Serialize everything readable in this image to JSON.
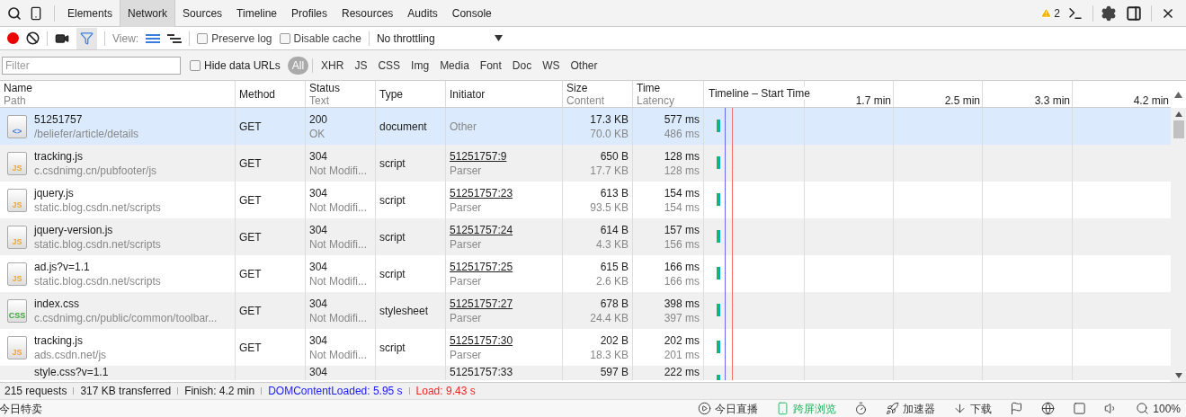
{
  "panel_tabs": [
    {
      "label": "Elements",
      "selected": false
    },
    {
      "label": "Network",
      "selected": true
    },
    {
      "label": "Sources",
      "selected": false
    },
    {
      "label": "Timeline",
      "selected": false
    },
    {
      "label": "Profiles",
      "selected": false
    },
    {
      "label": "Resources",
      "selected": false
    },
    {
      "label": "Audits",
      "selected": false
    },
    {
      "label": "Console",
      "selected": false
    }
  ],
  "warnings": {
    "count": "2"
  },
  "toolbar": {
    "recording": true,
    "filter_active": true,
    "view_label": "View:",
    "views": [
      {
        "kind": "list",
        "selected": true
      },
      {
        "kind": "overview",
        "selected": false
      }
    ],
    "options": [
      {
        "label": "Preserve log",
        "checked": false
      },
      {
        "label": "Disable cache",
        "checked": false
      }
    ],
    "throttling": "No throttling"
  },
  "filter_bar": {
    "placeholder": "Filter",
    "hide_data_urls": {
      "label": "Hide data URLs",
      "checked": false
    },
    "types": [
      {
        "label": "All",
        "selected": true
      },
      {
        "label": "XHR",
        "selected": false
      },
      {
        "label": "JS",
        "selected": false
      },
      {
        "label": "CSS",
        "selected": false
      },
      {
        "label": "Img",
        "selected": false
      },
      {
        "label": "Media",
        "selected": false
      },
      {
        "label": "Font",
        "selected": false
      },
      {
        "label": "Doc",
        "selected": false
      },
      {
        "label": "WS",
        "selected": false
      },
      {
        "label": "Other",
        "selected": false
      }
    ]
  },
  "table": {
    "columns": [
      {
        "title": "Name",
        "subtitle": "Path"
      },
      {
        "title": "Method"
      },
      {
        "title": "Status",
        "subtitle": "Text"
      },
      {
        "title": "Type"
      },
      {
        "title": "Initiator"
      },
      {
        "title": "Size",
        "subtitle": "Content"
      },
      {
        "title": "Time",
        "subtitle": "Latency"
      },
      {
        "title": "Timeline – Start Time"
      }
    ],
    "timeline_ticks": [
      "1.7 min",
      "2.5 min",
      "3.3 min",
      "4.2 min"
    ],
    "rows": [
      {
        "selected": true,
        "kind": "document",
        "icon_label": "<>",
        "name": "51251757",
        "path": "/beliefer/article/details",
        "method": "GET",
        "status": "200",
        "status_text": "OK",
        "type": "document",
        "initiator": "Other",
        "initiator_link": false,
        "size": "17.3 KB",
        "content": "70.0 KB",
        "time": "577 ms",
        "latency": "486 ms"
      },
      {
        "selected": false,
        "kind": "script",
        "icon_label": "JS",
        "name": "tracking.js",
        "path": "c.csdnimg.cn/pubfooter/js",
        "method": "GET",
        "status": "304",
        "status_text": "Not Modifi...",
        "type": "script",
        "initiator": "51251757:9",
        "initiator_link": true,
        "initiator_detail": "Parser",
        "size": "650 B",
        "content": "17.7 KB",
        "time": "128 ms",
        "latency": "128 ms"
      },
      {
        "selected": false,
        "kind": "script",
        "icon_label": "JS",
        "name": "jquery.js",
        "path": "static.blog.csdn.net/scripts",
        "method": "GET",
        "status": "304",
        "status_text": "Not Modifi...",
        "type": "script",
        "initiator": "51251757:23",
        "initiator_link": true,
        "initiator_detail": "Parser",
        "size": "613 B",
        "content": "93.5 KB",
        "time": "154 ms",
        "latency": "154 ms"
      },
      {
        "selected": false,
        "kind": "script",
        "icon_label": "JS",
        "name": "jquery-version.js",
        "path": "static.blog.csdn.net/scripts",
        "method": "GET",
        "status": "304",
        "status_text": "Not Modifi...",
        "type": "script",
        "initiator": "51251757:24",
        "initiator_link": true,
        "initiator_detail": "Parser",
        "size": "614 B",
        "content": "4.3 KB",
        "time": "157 ms",
        "latency": "156 ms"
      },
      {
        "selected": false,
        "kind": "script",
        "icon_label": "JS",
        "name": "ad.js?v=1.1",
        "path": "static.blog.csdn.net/scripts",
        "method": "GET",
        "status": "304",
        "status_text": "Not Modifi...",
        "type": "script",
        "initiator": "51251757:25",
        "initiator_link": true,
        "initiator_detail": "Parser",
        "size": "615 B",
        "content": "2.6 KB",
        "time": "166 ms",
        "latency": "166 ms"
      },
      {
        "selected": false,
        "kind": "stylesheet",
        "icon_label": "CSS",
        "name": "index.css",
        "path": "c.csdnimg.cn/public/common/toolbar...",
        "method": "GET",
        "status": "304",
        "status_text": "Not Modifi...",
        "type": "stylesheet",
        "initiator": "51251757:27",
        "initiator_link": true,
        "initiator_detail": "Parser",
        "size": "678 B",
        "content": "24.4 KB",
        "time": "398 ms",
        "latency": "397 ms"
      },
      {
        "selected": false,
        "kind": "script",
        "icon_label": "JS",
        "name": "tracking.js",
        "path": "ads.csdn.net/js",
        "method": "GET",
        "status": "304",
        "status_text": "Not Modifi...",
        "type": "script",
        "initiator": "51251757:30",
        "initiator_link": true,
        "initiator_detail": "Parser",
        "size": "202 B",
        "content": "18.3 KB",
        "time": "202 ms",
        "latency": "201 ms"
      },
      {
        "selected": false,
        "kind": "partial",
        "name": "style.css?v=1.1",
        "status": "304",
        "initiator": "51251757:33",
        "size": "597 B",
        "time": "222 ms"
      }
    ]
  },
  "summary": [
    {
      "text": "215 requests"
    },
    {
      "text": "317 KB transferred"
    },
    {
      "text": "Finish: 4.2 min"
    },
    {
      "text": "DOMContentLoaded: 5.95 s",
      "color": "#1a1aff"
    },
    {
      "text": "Load: 9.43 s",
      "color": "#ff2020"
    }
  ],
  "browser_bar": {
    "left": "今日特卖",
    "items": [
      {
        "kind": "live",
        "label": "今日直播"
      },
      {
        "kind": "cross",
        "label": "跨屏浏览",
        "highlight": true
      },
      {
        "kind": "speed-dial"
      },
      {
        "kind": "rocket",
        "label": "加速器"
      },
      {
        "kind": "download",
        "label": "下载"
      },
      {
        "kind": "flag"
      },
      {
        "kind": "ie"
      },
      {
        "kind": "window"
      },
      {
        "kind": "sound"
      },
      {
        "kind": "zoom",
        "label": "100%"
      }
    ]
  }
}
